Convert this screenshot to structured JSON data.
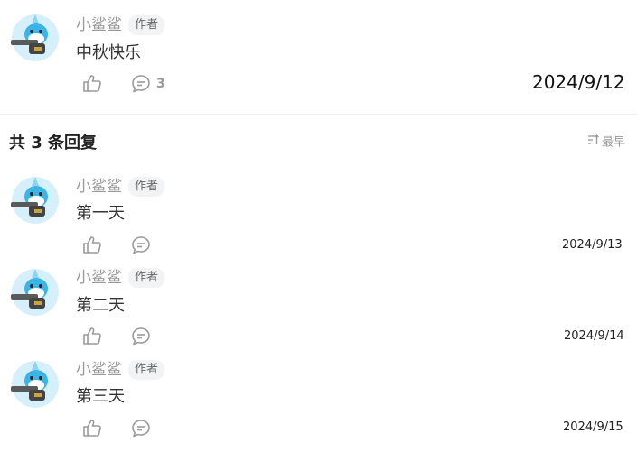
{
  "main_comment": {
    "author": "小鲨鲨",
    "badge": "作者",
    "text": "中秋快乐",
    "reply_count": "3",
    "date": "2024/9/12"
  },
  "replies_header": {
    "title": "共 3 条回复",
    "sort_label": "最早"
  },
  "replies": [
    {
      "author": "小鲨鲨",
      "badge": "作者",
      "text": "第一天",
      "date": "2024/9/13"
    },
    {
      "author": "小鲨鲨",
      "badge": "作者",
      "text": "第二天",
      "date": "2024/9/14"
    },
    {
      "author": "小鲨鲨",
      "badge": "作者",
      "text": "第三天",
      "date": "2024/9/15"
    }
  ],
  "icons": {
    "like": "thumbs-up-icon",
    "comment": "comment-bubble-icon",
    "sort": "sort-icon"
  },
  "colors": {
    "avatar_bg": "#bfe6f7",
    "shark": "#3bb5e6",
    "muted": "#999999"
  }
}
